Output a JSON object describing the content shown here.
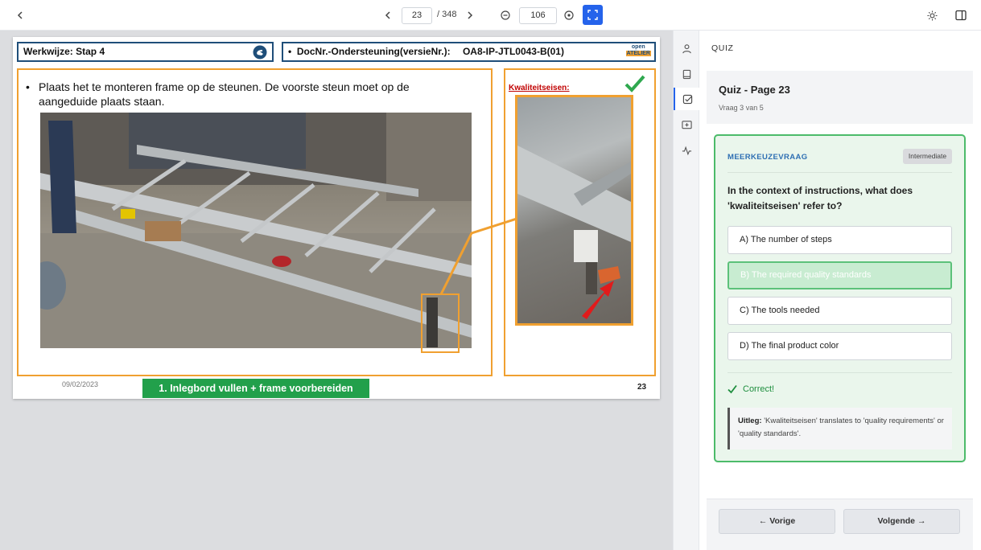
{
  "toolbar": {
    "back_icon": "chevron-left-icon",
    "current_page": "23",
    "total_pages": "/ 348",
    "zoom_value": "106",
    "prev_icon": "chevron-left-icon",
    "next_icon": "chevron-right-icon",
    "zoom_out_icon": "minus-circle-icon",
    "zoom_in_icon": "plus-circle-icon",
    "fit_icon": "fullscreen-icon",
    "theme_icon": "sun-icon",
    "panel_icon": "sidebar-toggle-icon",
    "accent": "#2563eb"
  },
  "slide": {
    "header_left": "Werkwijze: Stap  4",
    "header_right_label": "DocNr.-Ondersteuning(versieNr.):",
    "header_right_value": "OA8-IP-JTL0043-B(01)",
    "bullet": "Plaats het te monteren frame op de steunen. De voorste steun moet op de aangeduide plaats staan.",
    "quality_title": "Kwaliteitseisen:",
    "date": "09/02/2023",
    "footer_green": "1. Inlegbord vullen + frame voorbereiden",
    "page_number": "23",
    "logo_text_1": "open",
    "logo_text_2": "ATELIER"
  },
  "sidebar_icons": [
    "user-icon",
    "book-icon",
    "checkbox-icon",
    "slides-icon",
    "activity-icon"
  ],
  "panel": {
    "section_label": "QUIZ",
    "quiz_title": "Quiz - Page 23",
    "quiz_progress": "Vraag 3 van 5",
    "question_type": "MEERKEUZEVRAAG",
    "difficulty": "Intermediate",
    "question": "In the context of instructions, what does 'kwaliteitseisen' refer to?",
    "options": [
      "A) The number of steps",
      "B) The required quality standards",
      "C) The tools needed",
      "D) The final product color"
    ],
    "correct_index": 1,
    "result": "Correct!",
    "explanation_label": "Uitleg:",
    "explanation": "'Kwaliteitseisen' translates to 'quality requirements' or 'quality standards'.",
    "prev_button": "← Vorige",
    "next_button": "Volgende →",
    "success_color": "#1e8e3e"
  }
}
